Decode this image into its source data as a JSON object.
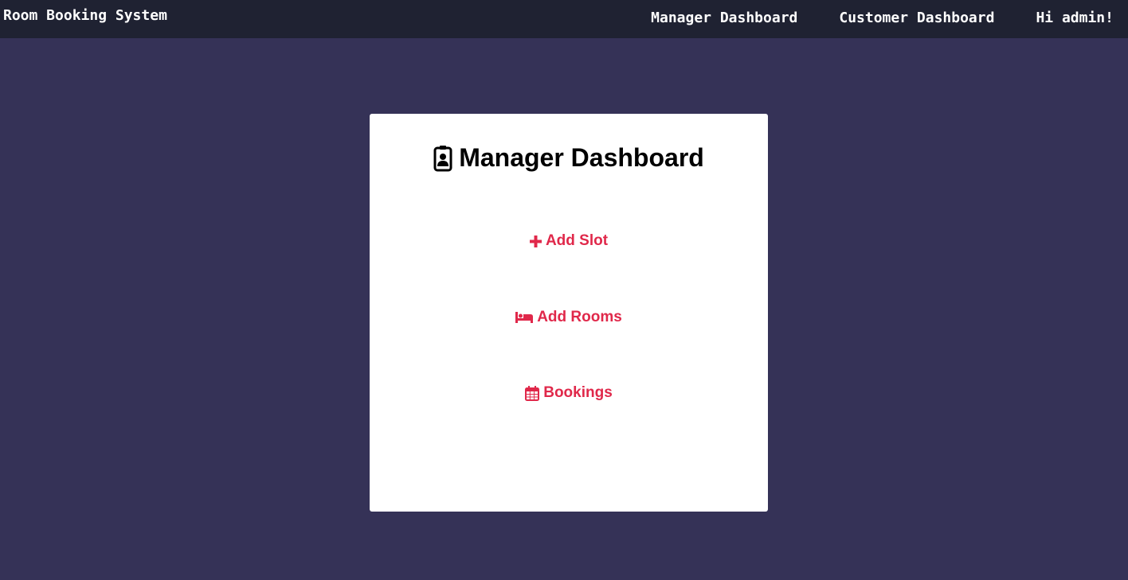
{
  "navbar": {
    "brand": "Room Booking System",
    "links": [
      {
        "label": "Manager Dashboard"
      },
      {
        "label": "Customer Dashboard"
      },
      {
        "label": "Hi admin!"
      }
    ]
  },
  "card": {
    "title": "Manager Dashboard",
    "title_icon": "id-badge-icon",
    "actions": [
      {
        "label": "Add Slot",
        "icon": "plus-icon"
      },
      {
        "label": "Add Rooms",
        "icon": "bed-icon"
      },
      {
        "label": "Bookings",
        "icon": "calendar-icon"
      }
    ]
  },
  "colors": {
    "background": "#353257",
    "navbar": "#1f2232",
    "card": "#ffffff",
    "accent": "#e0284a"
  }
}
